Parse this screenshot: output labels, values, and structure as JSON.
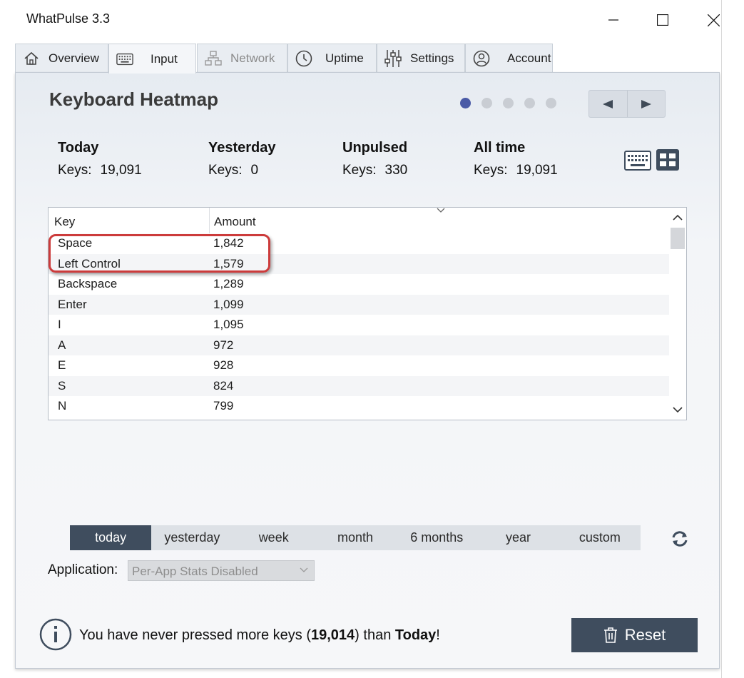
{
  "window": {
    "title": "WhatPulse 3.3"
  },
  "tabs": [
    {
      "label": "Overview",
      "icon": "home-icon"
    },
    {
      "label": "Input",
      "icon": "keyboard-icon",
      "active": true
    },
    {
      "label": "Network",
      "icon": "network-icon",
      "disabled": true
    },
    {
      "label": "Uptime",
      "icon": "clock-icon"
    },
    {
      "label": "Settings",
      "icon": "sliders-icon"
    },
    {
      "label": "Account",
      "icon": "user-icon"
    }
  ],
  "page": {
    "heading": "Keyboard Heatmap",
    "carousel_active_index": 0,
    "carousel_count": 5
  },
  "stats": {
    "today": {
      "label": "Today",
      "keys_label": "Keys:",
      "keys": "19,091"
    },
    "yesterday": {
      "label": "Yesterday",
      "keys_label": "Keys:",
      "keys": "0"
    },
    "unpulsed": {
      "label": "Unpulsed",
      "keys_label": "Keys:",
      "keys": "330"
    },
    "all_time": {
      "label": "All time",
      "keys_label": "Keys:",
      "keys": "19,091"
    }
  },
  "table": {
    "columns": [
      "Key",
      "Amount"
    ],
    "rows": [
      {
        "key": "Space",
        "amount": "1,842"
      },
      {
        "key": "Left Control",
        "amount": "1,579"
      },
      {
        "key": "Backspace",
        "amount": "1,289"
      },
      {
        "key": "Enter",
        "amount": "1,099"
      },
      {
        "key": "I",
        "amount": "1,095"
      },
      {
        "key": "A",
        "amount": "972"
      },
      {
        "key": "E",
        "amount": "928"
      },
      {
        "key": "S",
        "amount": "824"
      },
      {
        "key": "N",
        "amount": "799"
      }
    ]
  },
  "range": {
    "options": [
      "today",
      "yesterday",
      "week",
      "month",
      "6 months",
      "year",
      "custom"
    ],
    "selected": "today"
  },
  "application": {
    "label": "Application:",
    "value": "Per-App Stats Disabled"
  },
  "footer": {
    "prefix": "You have never pressed more keys (",
    "count": "19,014",
    "middle": ") than ",
    "day": "Today",
    "suffix": "!",
    "reset_label": "Reset"
  },
  "colors": {
    "accent": "#3f4d5e",
    "dot_active": "#4a5aa6",
    "highlight": "#cc3b3b"
  }
}
